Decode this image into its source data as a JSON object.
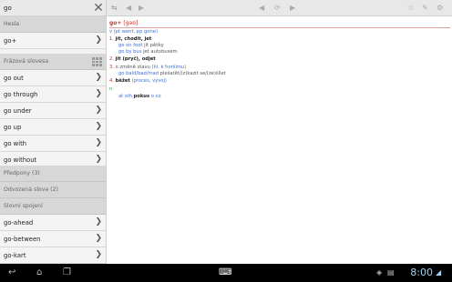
{
  "search": {
    "value": "go",
    "placeholder": ""
  },
  "left": {
    "headers": {
      "hesla": "Hesla",
      "phrasal": "Frázová slovesa",
      "prefixes": "Předpony (3)",
      "derived": "Odvozená slova (2)",
      "compounds": "Slovní spojení"
    },
    "hesla_items": [
      "go+"
    ],
    "phrasal_items": [
      "go out",
      "go through",
      "go under",
      "go up",
      "go with",
      "go without"
    ],
    "compound_items": [
      "go-ahead",
      "go-between",
      "go-kart"
    ]
  },
  "entry": {
    "headword": "go+",
    "pron": "[gəʊ]",
    "forms_line": "v (pt went, pp gone)",
    "senses": [
      {
        "num": "1.",
        "text": "jít, chodit, jet"
      },
      {
        "num": "",
        "example": "go on foot",
        "translation": "jít pěšky"
      },
      {
        "num": "",
        "example": "go by bus",
        "translation": "jet autobusem"
      },
      {
        "num": "2.",
        "text": "jít (pryč), odjet"
      },
      {
        "num": "3.",
        "text": "o změně stavu",
        "note": "(hl. k horšímu)"
      },
      {
        "num": "",
        "example": "go bald/bad/mad",
        "translation": "plešatět/(z)kazit se/(ze)šílet"
      },
      {
        "num": "4.",
        "text": "běžet",
        "note": "(proces, vývoj)"
      },
      {
        "num": "n",
        "text": ""
      },
      {
        "num": "",
        "example": "at sth",
        "translation": "pokus",
        "note": "o co"
      }
    ]
  },
  "navbar": {
    "time": "8:00"
  }
}
